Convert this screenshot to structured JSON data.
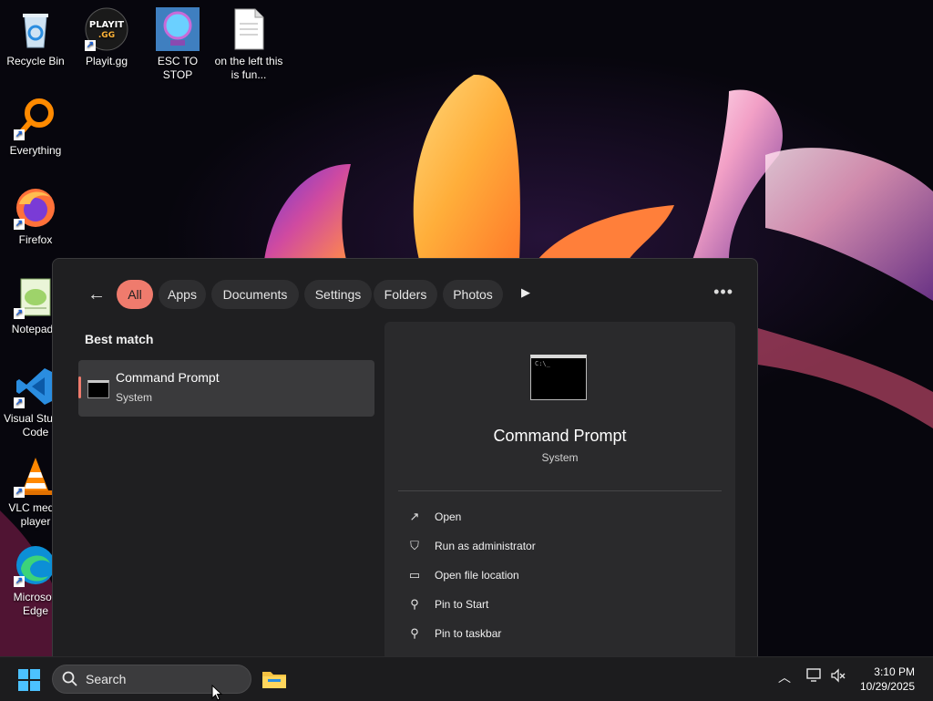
{
  "desktop": {
    "icons": [
      {
        "label": "Recycle Bin",
        "icon": "recycle-bin-icon"
      },
      {
        "label": "Playit.gg",
        "icon": "playit-icon",
        "logo_text": "PLAYIT .GG"
      },
      {
        "label": "ESC TO STOP",
        "icon": "globe-icon"
      },
      {
        "label": "on the left this is fun...",
        "icon": "text-file-icon"
      },
      {
        "label": "Everything",
        "icon": "everything-search-icon"
      },
      {
        "label": "Firefox",
        "icon": "firefox-icon"
      },
      {
        "label": "Notepad+",
        "icon": "notepad-plus-plus-icon"
      },
      {
        "label": "Visual Studio Code",
        "icon": "vscode-icon"
      },
      {
        "label": "VLC media player",
        "icon": "vlc-icon"
      },
      {
        "label": "Microsoft Edge",
        "icon": "edge-icon"
      }
    ]
  },
  "search_panel": {
    "back_icon": "back-arrow-icon",
    "filters": [
      "All",
      "Apps",
      "Documents",
      "Settings",
      "Folders",
      "Photos"
    ],
    "active_filter": "All",
    "more_label": "•••",
    "play_glyph": "▶",
    "best_match_label": "Best match",
    "result": {
      "title": "Command Prompt",
      "subtitle": "System"
    },
    "detail": {
      "title": "Command Prompt",
      "subtitle": "System",
      "actions": [
        {
          "label": "Open",
          "icon": "open-external-icon"
        },
        {
          "label": "Run as administrator",
          "icon": "admin-shield-icon"
        },
        {
          "label": "Open file location",
          "icon": "folder-icon"
        },
        {
          "label": "Pin to Start",
          "icon": "pin-icon"
        },
        {
          "label": "Pin to taskbar",
          "icon": "pin-icon"
        }
      ]
    }
  },
  "taskbar": {
    "search_placeholder": "Search",
    "time": "3:10 PM",
    "date": "10/29/2025"
  },
  "colors": {
    "accent": "#ef7b6d",
    "panel_bg": "#1f1f21",
    "taskbar_bg": "#1c1c1e",
    "start_blue": "#4cc2ff"
  }
}
